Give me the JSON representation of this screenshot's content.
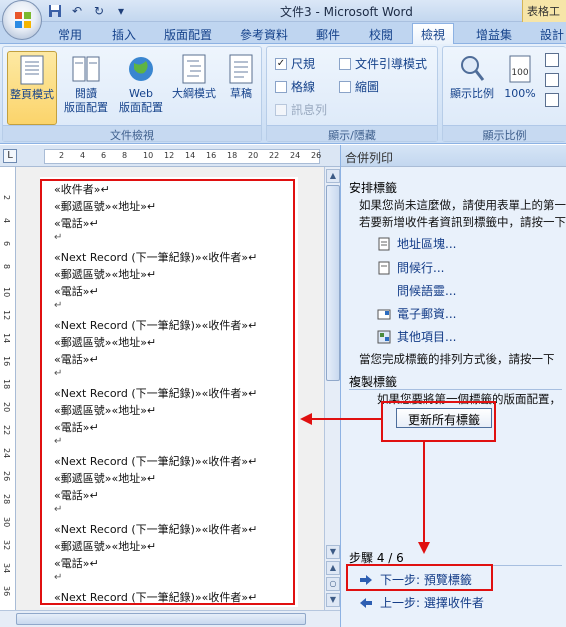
{
  "window": {
    "title": "文件3 - Microsoft Word",
    "context_tab": "表格工"
  },
  "tabs": [
    "常用",
    "插入",
    "版面配置",
    "參考資料",
    "郵件",
    "校閱",
    "檢視",
    "增益集",
    "設計"
  ],
  "active_tab": "檢視",
  "ribbon": {
    "views_group": {
      "label": "文件檢視",
      "buttons": [
        "整頁模式",
        "閱讀\n版面配置",
        "Web\n版面配置",
        "大綱模式",
        "草稿"
      ]
    },
    "show_group": {
      "label": "顯示/隱藏",
      "checks": [
        {
          "label": "尺規",
          "checked": true
        },
        {
          "label": "文件引導模式",
          "checked": false
        },
        {
          "label": "格線",
          "checked": false
        },
        {
          "label": "縮圖",
          "checked": false
        },
        {
          "label": "訊息列",
          "checked": false
        }
      ]
    },
    "zoom_group": {
      "label": "顯示比例",
      "zoom_label": "顯示比例",
      "percent_label": "100%"
    }
  },
  "ruler": {
    "h_ticks": [
      "2",
      "4",
      "6",
      "8",
      "10",
      "12",
      "14",
      "16",
      "18",
      "20",
      "22",
      "24",
      "26"
    ],
    "v_ticks": [
      "2",
      "4",
      "6",
      "8",
      "10",
      "12",
      "14",
      "16",
      "18",
      "20",
      "22",
      "24",
      "26",
      "28",
      "30",
      "32",
      "34",
      "36"
    ]
  },
  "document": {
    "lines": [
      "«收件者»",
      "«郵遞區號»«地址»",
      "«電話»",
      "",
      "«Next Record (下一筆紀錄)»«收件者»",
      "«郵遞區號»«地址»",
      "«電話»",
      "",
      "«Next Record (下一筆紀錄)»«收件者»",
      "«郵遞區號»«地址»",
      "«電話»",
      "",
      "«Next Record (下一筆紀錄)»«收件者»",
      "«郵遞區號»«地址»",
      "«電話»",
      "",
      "«Next Record (下一筆紀錄)»«收件者»",
      "«郵遞區號»«地址»",
      "«電話»",
      "",
      "«Next Record (下一筆紀錄)»«收件者»",
      "«郵遞區號»«地址»",
      "«電話»",
      "",
      "«Next Record (下一筆紀錄)»«收件者»"
    ]
  },
  "task_pane": {
    "title": "合併列印",
    "arrange_heading": "安排標籤",
    "arrange_text1": "如果您尚未這麼做，請使用表單上的第一",
    "arrange_text2": "若要新增收件者資訊到標籤中，請按一下",
    "links": [
      "地址區塊...",
      "問候行...",
      "問候語靈...",
      "電子郵資...",
      "其他項目..."
    ],
    "after_text": "當您完成標籤的排列方式後，請按一下",
    "copy_heading": "複製標籤",
    "copy_text": "如果您要將第一個標籤的版面配置，",
    "update_button": "更新所有標籤",
    "step_label": "步驟 4 / 6",
    "next_step": "下一步: 預覽標籤",
    "prev_step": "上一步: 選擇收件者"
  },
  "colors": {
    "annotation_red": "#e01010",
    "ribbon_blue": "#15428b"
  }
}
